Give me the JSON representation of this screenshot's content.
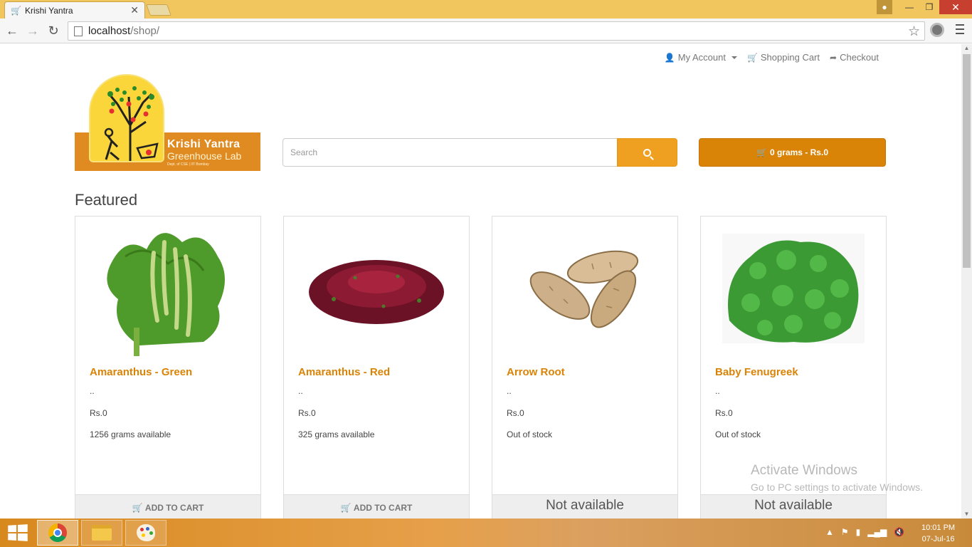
{
  "browser": {
    "tab_title": "Krishi Yantra",
    "url_host": "localhost",
    "url_path": "/shop/"
  },
  "header_links": {
    "account": "My Account",
    "cart": "Shopping Cart",
    "checkout": "Checkout"
  },
  "logo": {
    "brand_name": "Krishi Yantra",
    "brand_sub": "Greenhouse Lab",
    "brand_dept": "Dept. of CSE | IIT Bombay"
  },
  "search": {
    "placeholder": "Search"
  },
  "cart_summary": "0 grams - Rs.0",
  "featured_heading": "Featured",
  "products": [
    {
      "name": "Amaranthus - Green",
      "description": "..",
      "price": "Rs.0",
      "availability": "1256 grams available",
      "action": "ADD TO CART",
      "image": "amaranthus-green"
    },
    {
      "name": "Amaranthus - Red",
      "description": "..",
      "price": "Rs.0",
      "availability": "325 grams available",
      "action": "ADD TO CART",
      "image": "amaranthus-red"
    },
    {
      "name": "Arrow Root",
      "description": "..",
      "price": "Rs.0",
      "availability": "Out of stock",
      "action": "Not available",
      "image": "arrow-root"
    },
    {
      "name": "Baby Fenugreek",
      "description": "..",
      "price": "Rs.0",
      "availability": "Out of stock",
      "action": "Not available",
      "image": "baby-fenugreek"
    }
  ],
  "watermark": {
    "line1": "Activate Windows",
    "line2": "Go to PC settings to activate Windows."
  },
  "taskbar": {
    "time": "10:01 PM",
    "date": "07-Jul-16"
  },
  "colors": {
    "accent": "#d98307",
    "search_button": "#f0a020",
    "taskbar": "#d8891e"
  }
}
